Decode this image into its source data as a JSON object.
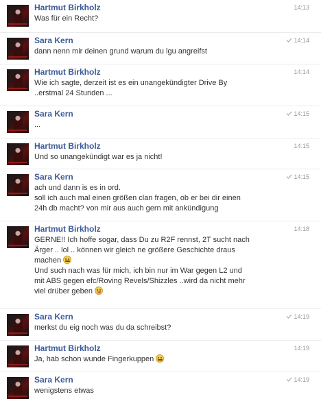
{
  "messages": [
    {
      "sender": "Hartmut Birkholz",
      "time": "14:13",
      "seen": false,
      "lines": [
        "Was für ein Recht?"
      ]
    },
    {
      "sender": "Sara Kern",
      "time": "14:14",
      "seen": true,
      "lines": [
        "dann nenn mir deinen grund warum du lgu angreifst"
      ]
    },
    {
      "sender": "Hartmut Birkholz",
      "time": "14:14",
      "seen": false,
      "lines": [
        "Wie ich sagte, derzeit ist es ein unangekündigter Drive By",
        "..erstmal 24 Stunden ..."
      ]
    },
    {
      "sender": "Sara Kern",
      "time": "14:15",
      "seen": true,
      "lines": [
        "..."
      ]
    },
    {
      "sender": "Hartmut Birkholz",
      "time": "14:15",
      "seen": false,
      "lines": [
        "Und so unangekündigt war es ja nicht!"
      ]
    },
    {
      "sender": "Sara Kern",
      "time": "14:15",
      "seen": true,
      "lines": [
        "ach und dann is es in ord.",
        "soll ich auch mal einen größen clan fragen, ob er bei dir einen",
        "24h db macht? von mir aus auch gern mit ankündigung"
      ]
    },
    {
      "sender": "Hartmut Birkholz",
      "time": "14:18",
      "seen": false,
      "lines": [
        "GERNE!! Ich hoffe sogar, dass Du zu R2F rennst, 2T sucht nach",
        "Ärger .. lol .. können wir gleich ne größere Geschichte draus",
        "machen",
        "Und such nach was für mich, ich bin nur im War gegen L2 und",
        "mit ABS gegen efc/Roving Revels/Shizzles ..wird da nicht mehr",
        "viel drüber geben"
      ]
    },
    {
      "sender": "Sara Kern",
      "time": "14:19",
      "seen": true,
      "lines": [
        "merkst du eig noch was du da schreibst?"
      ]
    },
    {
      "sender": "Hartmut Birkholz",
      "time": "14:19",
      "seen": false,
      "lines": [
        "Ja, hab schon wunde Fingerkuppen"
      ]
    },
    {
      "sender": "Sara Kern",
      "time": "14:19",
      "seen": true,
      "lines": [
        "wenigstens etwas"
      ]
    }
  ]
}
